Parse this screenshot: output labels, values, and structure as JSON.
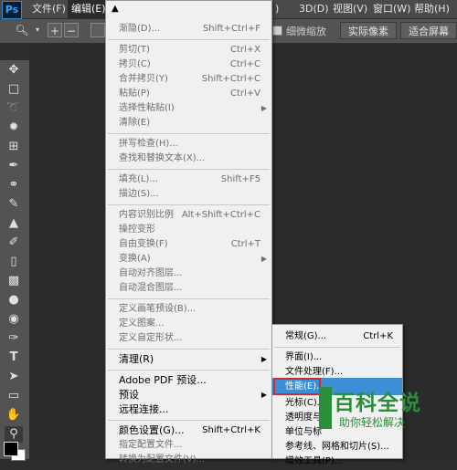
{
  "app": {
    "logo": "Ps"
  },
  "menubar": {
    "items": [
      {
        "label": "文件(F)"
      },
      {
        "label": "编辑(E)"
      },
      {
        "label": "3D(D)"
      },
      {
        "label": "视图(V)"
      },
      {
        "label": "窗口(W)"
      },
      {
        "label": "帮助(H)"
      }
    ],
    "partial": ")"
  },
  "options": {
    "checkbox_label": "细微缩放",
    "actual_pixels": "实际像素",
    "fit_screen": "适合屏幕"
  },
  "edit_menu": {
    "scroll_up_icon": "triangle-up-icon",
    "items": [
      {
        "label": "渐隐(D)...",
        "shortcut": "Shift+Ctrl+F",
        "disabled": true
      },
      {
        "label": "剪切(T)",
        "shortcut": "Ctrl+X",
        "disabled": true
      },
      {
        "label": "拷贝(C)",
        "shortcut": "Ctrl+C",
        "disabled": true
      },
      {
        "label": "合并拷贝(Y)",
        "shortcut": "Shift+Ctrl+C",
        "disabled": true
      },
      {
        "label": "粘贴(P)",
        "shortcut": "Ctrl+V",
        "disabled": true
      },
      {
        "label": "选择性粘贴(I)",
        "shortcut": "",
        "submenu": true,
        "disabled": true
      },
      {
        "label": "清除(E)",
        "shortcut": "",
        "disabled": true
      },
      {
        "label": "拼写检查(H)...",
        "shortcut": "",
        "disabled": true
      },
      {
        "label": "查找和替换文本(X)...",
        "shortcut": "",
        "disabled": true
      },
      {
        "label": "填充(L)...",
        "shortcut": "Shift+F5",
        "disabled": true
      },
      {
        "label": "描边(S)...",
        "shortcut": "",
        "disabled": true
      },
      {
        "label": "内容识别比例",
        "shortcut": "Alt+Shift+Ctrl+C",
        "disabled": true
      },
      {
        "label": "操控变形",
        "shortcut": "",
        "disabled": true
      },
      {
        "label": "自由变换(F)",
        "shortcut": "Ctrl+T",
        "disabled": true
      },
      {
        "label": "变换(A)",
        "shortcut": "",
        "submenu": true,
        "disabled": true
      },
      {
        "label": "自动对齐图层...",
        "shortcut": "",
        "disabled": true
      },
      {
        "label": "自动混合图层...",
        "shortcut": "",
        "disabled": true
      },
      {
        "label": "定义画笔预设(B)...",
        "shortcut": "",
        "disabled": true
      },
      {
        "label": "定义图案...",
        "shortcut": "",
        "disabled": true
      },
      {
        "label": "定义自定形状...",
        "shortcut": "",
        "disabled": true
      },
      {
        "label": "清理(R)",
        "shortcut": "",
        "submenu": true,
        "disabled": false
      },
      {
        "label": "Adobe PDF 预设...",
        "shortcut": "",
        "disabled": false
      },
      {
        "label": "预设",
        "shortcut": "",
        "submenu": true,
        "disabled": false
      },
      {
        "label": "远程连接...",
        "shortcut": "",
        "disabled": false
      },
      {
        "label": "颜色设置(G)...",
        "shortcut": "Shift+Ctrl+K",
        "disabled": false
      },
      {
        "label": "指定配置文件...",
        "shortcut": "",
        "disabled": true
      },
      {
        "label": "转换为配置文件(V)...",
        "shortcut": "",
        "disabled": true
      }
    ]
  },
  "pref_menu": {
    "items": [
      {
        "label": "常规(G)...",
        "shortcut": "Ctrl+K"
      },
      {
        "label": "界面(I)...",
        "shortcut": ""
      },
      {
        "label": "文件处理(F)...",
        "shortcut": ""
      },
      {
        "label": "性能(E)...",
        "shortcut": "",
        "highlighted": true
      },
      {
        "label": "光标(C)...",
        "shortcut": ""
      },
      {
        "label": "透明度与",
        "shortcut": ""
      },
      {
        "label": "单位与标",
        "shortcut": ""
      },
      {
        "label": "参考线、网格和切片(S)...",
        "shortcut": ""
      },
      {
        "label": "增效工具(P)...",
        "shortcut": ""
      }
    ]
  },
  "watermark": {
    "title": "百科全说",
    "subtitle": "助你轻松解决"
  },
  "colors": {
    "menu_bg": "#f0f0f0",
    "highlight": "#3b8fd6",
    "callout_border": "#d42a2a",
    "watermark": "#2b8e3a",
    "ui_dark": "#535353"
  }
}
